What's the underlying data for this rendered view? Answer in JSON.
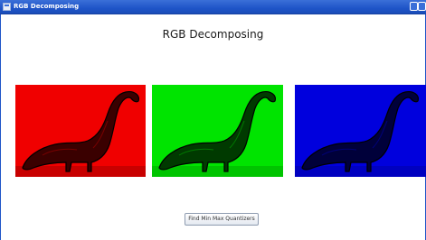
{
  "window": {
    "title": "RGB Decomposing"
  },
  "main": {
    "heading": "RGB Decomposing",
    "panels": [
      {
        "channel": "red",
        "color": "#f00000"
      },
      {
        "channel": "green",
        "color": "#00e400"
      },
      {
        "channel": "blue",
        "color": "#0000dd"
      }
    ],
    "button_label": "Find Min Max Quantizers"
  },
  "icons": [
    "app-icon",
    "minimize-icon",
    "close-icon",
    "dinosaur-image"
  ]
}
